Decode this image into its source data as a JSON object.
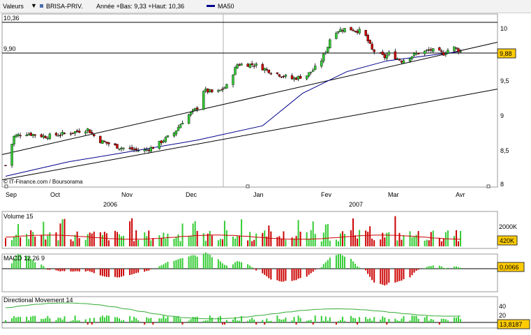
{
  "header": {
    "menu_label": "Valeurs",
    "ticker": "BRISA-PRIV.",
    "range_text": "Année +Bas: 9,33 +Haut: 10,36",
    "ma_label": "MA50",
    "ma_color": "#00008b"
  },
  "colors": {
    "up": "#33cc33",
    "down": "#cc0000",
    "ma": "#00008b",
    "highlight": "#ffcc00"
  },
  "price_panel": {
    "label_high": "10,36",
    "label_ref": "9,90",
    "current_value": "9,88",
    "ticks": [
      "10",
      "9,5",
      "9",
      "8,5",
      "8"
    ],
    "credit": "© IT-Finance.com / Boursorama",
    "months": [
      "Sep",
      "Oct",
      "Nov",
      "Dec",
      "Jan",
      "Fev",
      "Mar",
      "Avr"
    ],
    "years": [
      "2006",
      "2007"
    ]
  },
  "volume_panel": {
    "label": "Volume 15",
    "tick": "2000K",
    "current_value": "420K"
  },
  "macd_panel": {
    "label": "MACD 12 26 9",
    "current_value": "0,0066"
  },
  "dm_panel": {
    "label": "Directional Movement 14",
    "ticks": [
      "40",
      "20"
    ],
    "current_value": "13,8187"
  },
  "chart_data": [
    {
      "type": "candlestick",
      "title": "BRISA-PRIV.",
      "x_range": [
        "2006-09",
        "2007-04"
      ],
      "ylim": [
        8,
        10.4
      ],
      "checkpoints": [
        {
          "x": "2006-09-01",
          "y": 8.3
        },
        {
          "x": "2006-09-05",
          "y": 8.7
        },
        {
          "x": "2006-09-10",
          "y": 8.75
        },
        {
          "x": "2006-09-20",
          "y": 8.7
        },
        {
          "x": "2006-10-01",
          "y": 8.75
        },
        {
          "x": "2006-10-10",
          "y": 8.8
        },
        {
          "x": "2006-10-15",
          "y": 8.65
        },
        {
          "x": "2006-10-25",
          "y": 8.55
        },
        {
          "x": "2006-11-05",
          "y": 8.5
        },
        {
          "x": "2006-11-10",
          "y": 8.55
        },
        {
          "x": "2006-11-20",
          "y": 8.75
        },
        {
          "x": "2006-11-25",
          "y": 8.95
        },
        {
          "x": "2006-12-01",
          "y": 9.1
        },
        {
          "x": "2006-12-03",
          "y": 9.35
        },
        {
          "x": "2006-12-10",
          "y": 9.3
        },
        {
          "x": "2006-12-15",
          "y": 9.4
        },
        {
          "x": "2006-12-20",
          "y": 9.7
        },
        {
          "x": "2006-12-28",
          "y": 9.7
        },
        {
          "x": "2007-01-05",
          "y": 9.6
        },
        {
          "x": "2007-01-15",
          "y": 9.5
        },
        {
          "x": "2007-01-22",
          "y": 9.55
        },
        {
          "x": "2007-01-28",
          "y": 9.7
        },
        {
          "x": "2007-02-01",
          "y": 9.95
        },
        {
          "x": "2007-02-03",
          "y": 10.15
        },
        {
          "x": "2007-02-10",
          "y": 10.2
        },
        {
          "x": "2007-02-18",
          "y": 10.15
        },
        {
          "x": "2007-02-22",
          "y": 9.9
        },
        {
          "x": "2007-02-28",
          "y": 9.8
        },
        {
          "x": "2007-03-02",
          "y": 9.85
        },
        {
          "x": "2007-03-08",
          "y": 9.75
        },
        {
          "x": "2007-03-15",
          "y": 9.85
        },
        {
          "x": "2007-03-22",
          "y": 9.9
        },
        {
          "x": "2007-03-28",
          "y": 9.85
        },
        {
          "x": "2007-04-01",
          "y": 9.95
        },
        {
          "x": "2007-04-05",
          "y": 9.88
        }
      ],
      "ma50": [
        {
          "x": "2006-09-01",
          "y": 8.15
        },
        {
          "x": "2006-10-01",
          "y": 8.35
        },
        {
          "x": "2006-11-01",
          "y": 8.5
        },
        {
          "x": "2006-12-01",
          "y": 8.65
        },
        {
          "x": "2007-01-01",
          "y": 8.85
        },
        {
          "x": "2007-01-20",
          "y": 9.3
        },
        {
          "x": "2007-02-10",
          "y": 9.6
        },
        {
          "x": "2007-03-01",
          "y": 9.75
        },
        {
          "x": "2007-03-20",
          "y": 9.82
        },
        {
          "x": "2007-04-05",
          "y": 9.88
        }
      ],
      "trend_lines": [
        {
          "from": {
            "x": "2006-09-01",
            "y": 8.45
          },
          "to": {
            "x": "2007-04-05",
            "y": 9.95
          }
        },
        {
          "from": {
            "x": "2006-09-01",
            "y": 8.1
          },
          "to": {
            "x": "2007-04-05",
            "y": 9.3
          }
        },
        {
          "from": {
            "x": "2006-09-01",
            "y": 10.36
          },
          "to": {
            "x": "2007-04-05",
            "y": 10.36
          }
        },
        {
          "from": {
            "x": "2006-09-01",
            "y": 9.9
          },
          "to": {
            "x": "2007-04-05",
            "y": 9.9
          }
        }
      ]
    },
    {
      "type": "bar",
      "title": "Volume 15",
      "ylim": [
        0,
        3000000
      ]
    },
    {
      "type": "bar",
      "title": "MACD 12 26 9"
    },
    {
      "type": "line",
      "title": "Directional Movement 14",
      "ylim": [
        0,
        40
      ]
    }
  ]
}
